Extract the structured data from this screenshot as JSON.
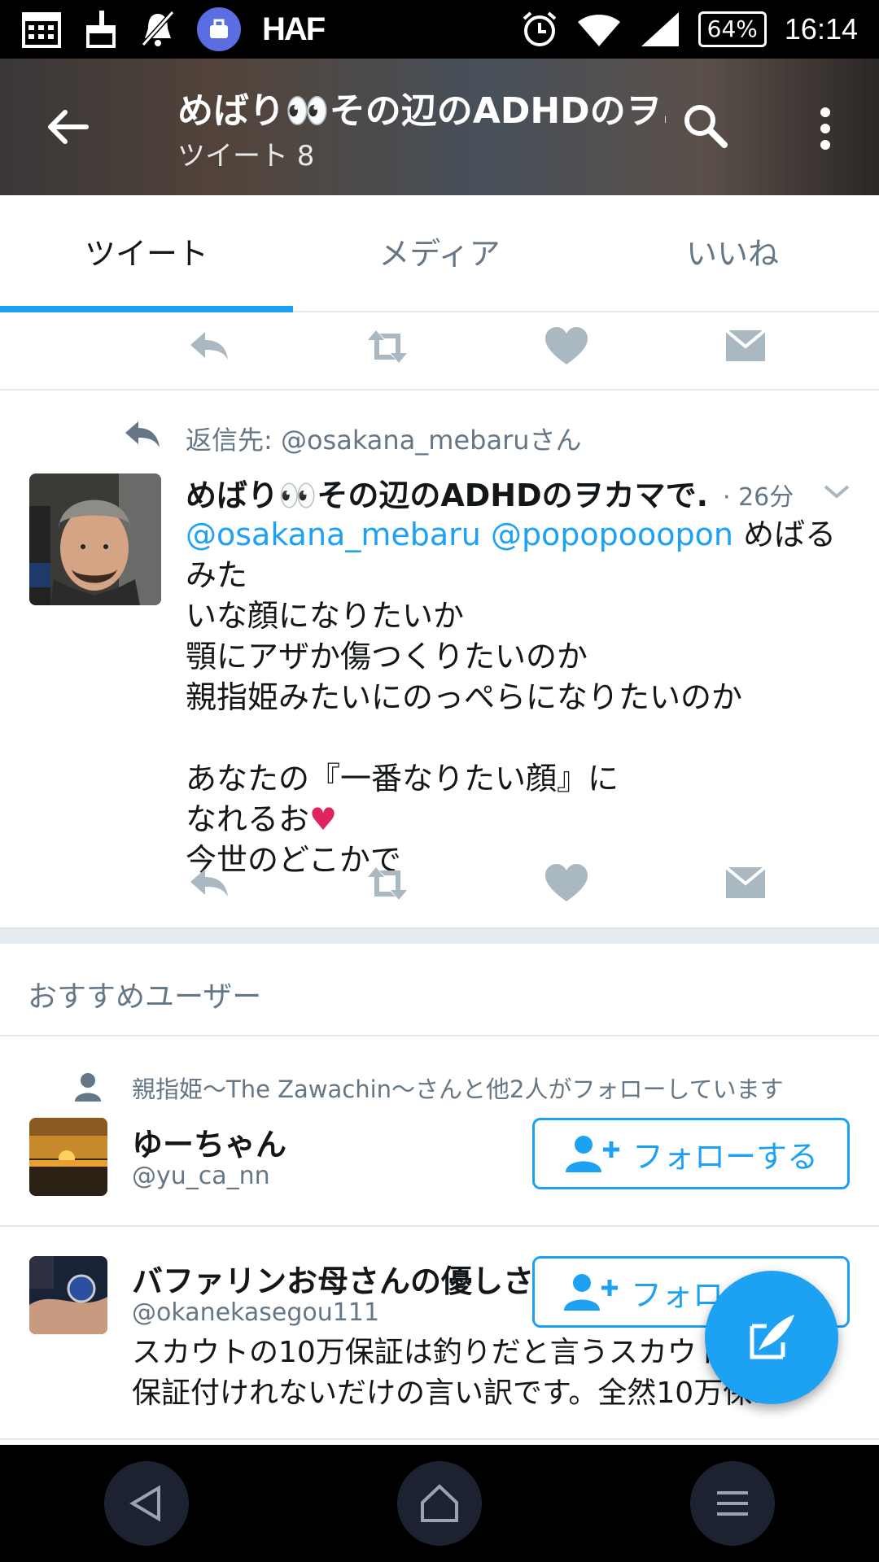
{
  "status_bar": {
    "time": "16:14",
    "battery": "64%",
    "left_text": "HAF",
    "icons": [
      "calendar-icon",
      "cleaner-icon",
      "mute-icon",
      "app-icon",
      "alarm-icon",
      "wifi-icon",
      "signal-icon",
      "battery-icon"
    ]
  },
  "header": {
    "title": "めばり👀その辺のADHDのヲ...",
    "subtitle": "ツイート 8"
  },
  "tabs": [
    {
      "label": "ツイート",
      "active": true
    },
    {
      "label": "メディア",
      "active": false
    },
    {
      "label": "いいね",
      "active": false
    }
  ],
  "tweet": {
    "reply_label": "返信先: ",
    "reply_handle": "@osakana_mebaru",
    "reply_suffix": "さん",
    "author": "めばり👀その辺のADHDのヲカマで...",
    "time": "· 26分",
    "mention1": "@osakana_mebaru",
    "mention2": "@popopooopon",
    "line1_rest": " めばるみた",
    "line2": "いな顔になりたいか",
    "line3": "顎にアザか傷つくりたいのか",
    "line4": "親指姫みたいにのっぺらになりたいのか",
    "line5": "あなたの『一番なりたい顔』に",
    "line6": "なれるお",
    "heart": "♥",
    "line7": "今世のどこかで"
  },
  "recommend": {
    "title": "おすすめユーザー",
    "users": [
      {
        "social_context": "親指姫〜The Zawachin〜さんと他2人がフォローしています",
        "name": "ゆーちゃん",
        "handle": "@yu_ca_nn",
        "follow_label": "フォローする"
      },
      {
        "name": "バファリンお母さんの優しさ",
        "handle": "@okanekasegou111",
        "follow_label": "フォロー",
        "bio_line1": "スカウトの10万保証は釣りだと言うスカウト",
        "bio_line2": "保証付けれないだけの言い訳です。全然10万保..."
      }
    ]
  },
  "colors": {
    "accent": "#1da1f2",
    "secondary_text": "#657786",
    "heart": "#e0245e"
  }
}
